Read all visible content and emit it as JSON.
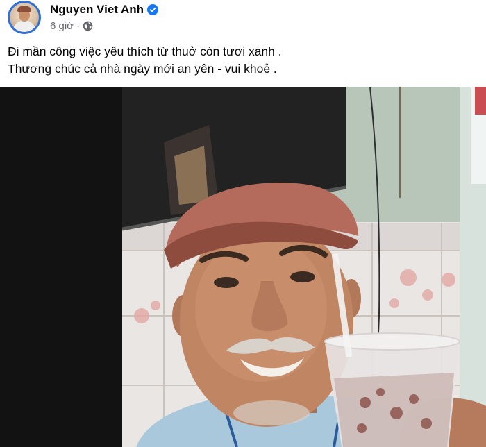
{
  "post": {
    "author_name": "Nguyen Viet Anh",
    "verified_icon": "verified-badge-icon",
    "timestamp": "6 giờ",
    "separator": "·",
    "audience_icon": "globe-icon",
    "caption_lines": [
      "Đi mần công việc yêu thích từ thuở còn tươi xanh .",
      "Thương chúc cả nhà ngày mới an yên - vui khoẻ ."
    ],
    "photo": {
      "subject": "selfie-photo"
    }
  },
  "colors": {
    "verified": "#1877f2",
    "meta_text": "#65676b",
    "text": "#050505",
    "photo_letterbox": "#121212"
  }
}
